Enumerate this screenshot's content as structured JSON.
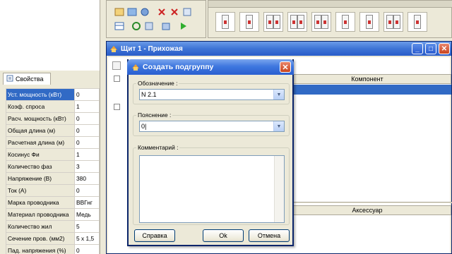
{
  "child_window": {
    "title": "Щит 1 - Прихожая",
    "column_component": "Компонент",
    "column_accessory": "Аксессуар"
  },
  "properties": {
    "tab_label": "Свойства",
    "rows": [
      {
        "key": "Уст. мощность (кВт)",
        "value": "0"
      },
      {
        "key": "Коэф. спроса",
        "value": "1"
      },
      {
        "key": "Расч. мощность (кВт)",
        "value": "0"
      },
      {
        "key": "Общая длина (м)",
        "value": "0"
      },
      {
        "key": "Расчетная длина (м)",
        "value": "0"
      },
      {
        "key": "Косинус Фи",
        "value": "1"
      },
      {
        "key": "Количество фаз",
        "value": "3"
      },
      {
        "key": "Напряжение (В)",
        "value": "380"
      },
      {
        "key": "Ток (А)",
        "value": "0"
      },
      {
        "key": "Марка проводника",
        "value": "ВВГнг"
      },
      {
        "key": "Материал проводника",
        "value": "Медь"
      },
      {
        "key": "Количество жил",
        "value": "5"
      },
      {
        "key": "Сечение пров. (мм2)",
        "value": "5 x 1,5"
      },
      {
        "key": "Пад. напряжения (%)",
        "value": "0"
      }
    ]
  },
  "dialog": {
    "title": "Создать подгруппу",
    "designation_label": "Обозначение :",
    "designation_value": "N 2.1",
    "explanation_label": "Пояснение :",
    "explanation_value": "0|",
    "comment_label": "Комментарий :",
    "help_button": "Справка",
    "ok_button": "Ok",
    "cancel_button": "Отмена"
  },
  "icons": [
    "app-icon",
    "close-icon",
    "minimize-icon",
    "maximize-icon",
    "dropdown-arrow-icon",
    "breaker-icon",
    "properties-icon"
  ],
  "colors": {
    "title_bar": "#2a5cc8",
    "selection": "#316ac5",
    "close": "#c9441e"
  }
}
